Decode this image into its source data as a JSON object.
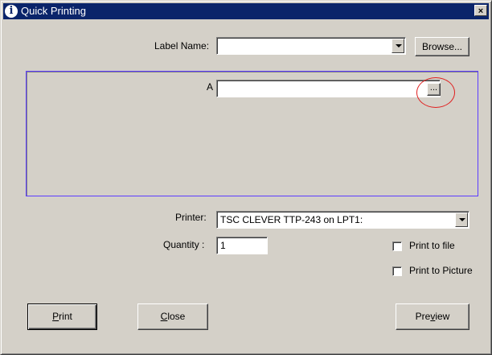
{
  "window": {
    "title": "Quick Printing",
    "close_glyph": "×"
  },
  "label_name": {
    "label": "Label Name:",
    "value": "",
    "browse_label": "Browse..."
  },
  "variable": {
    "name": "A",
    "value": "",
    "ellipsis_label": "..."
  },
  "printer": {
    "label": "Printer:",
    "value": "TSC CLEVER TTP-243 on LPT1:"
  },
  "quantity": {
    "label": "Quantity :",
    "value": "1"
  },
  "options": {
    "print_to_file": {
      "label": "Print to file",
      "checked": false
    },
    "print_to_picture": {
      "label": "Print to Picture",
      "checked": false
    }
  },
  "buttons": {
    "print": {
      "text": "Print",
      "mnemonic": "P",
      "rest": "rint"
    },
    "close": {
      "text": "Close",
      "mnemonic": "C",
      "rest": "lose"
    },
    "preview": {
      "pre": "Pre",
      "mnemonic": "v",
      "rest": "iew"
    }
  },
  "colors": {
    "titlebar": "#0a246a",
    "panel_border": "#5c3cff",
    "highlight": "#e02020",
    "face": "#d4d0c8"
  }
}
